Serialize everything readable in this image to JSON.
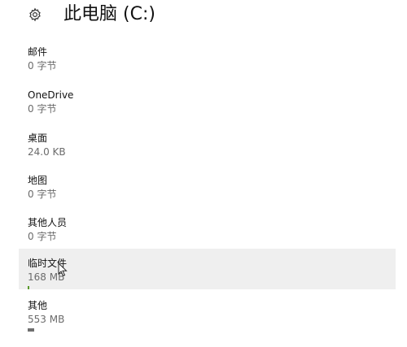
{
  "header": {
    "title": "此电脑 (C:)",
    "icon": "gear-icon"
  },
  "items": [
    {
      "label": "邮件",
      "size": "0 字节",
      "usage": 0
    },
    {
      "label": "OneDrive",
      "size": "0 字节",
      "usage": 0
    },
    {
      "label": "桌面",
      "size": "24.0 KB",
      "usage": 0
    },
    {
      "label": "地图",
      "size": "0 字节",
      "usage": 0
    },
    {
      "label": "其他人员",
      "size": "0 字节",
      "usage": 0
    },
    {
      "label": "临时文件",
      "size": "168 MB",
      "usage": 0.02,
      "selected": true
    },
    {
      "label": "其他",
      "size": "553 MB",
      "usage": 0.07
    }
  ],
  "colors": {
    "selected_background": "#efefef",
    "usage_bar": "#6f6f6f",
    "usage_bar_accent": "#5a9a2a"
  }
}
